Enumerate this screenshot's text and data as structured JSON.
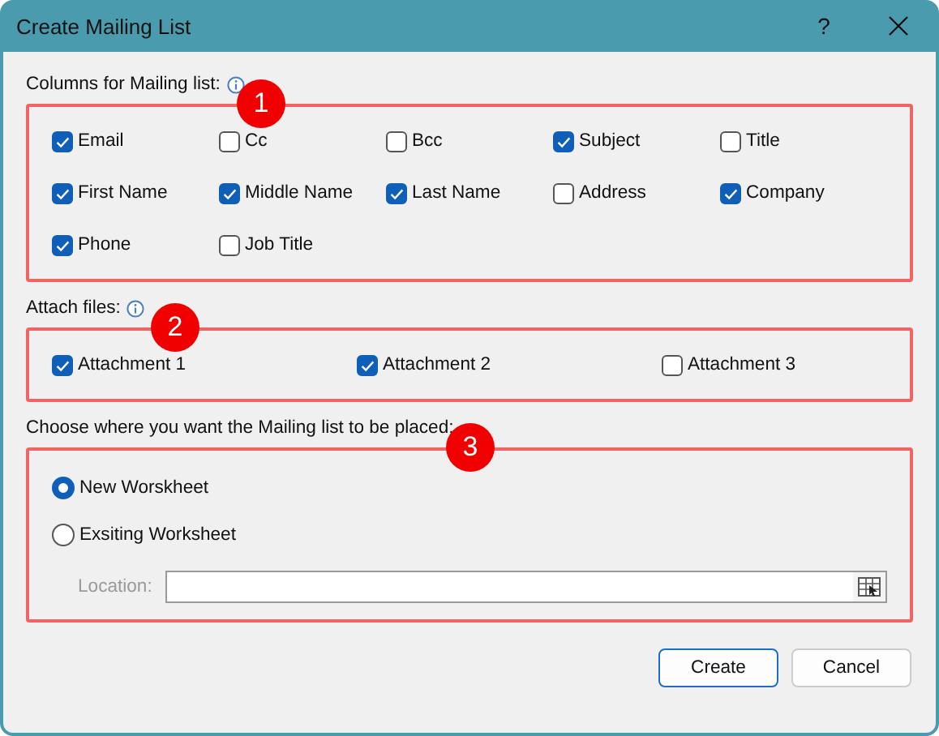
{
  "window": {
    "title": "Create Mailing List",
    "help": "?"
  },
  "sections": [
    {
      "kind": "checkboxes",
      "label": "Columns for Mailing list:",
      "info": true,
      "badge": "1",
      "items": [
        {
          "label": "Email",
          "checked": true
        },
        {
          "label": "Cc",
          "checked": false
        },
        {
          "label": "Bcc",
          "checked": false
        },
        {
          "label": "Subject",
          "checked": true
        },
        {
          "label": "Title",
          "checked": false
        },
        {
          "label": "First Name",
          "checked": true
        },
        {
          "label": "Middle Name",
          "checked": true
        },
        {
          "label": "Last Name",
          "checked": true
        },
        {
          "label": "Address",
          "checked": false
        },
        {
          "label": "Company",
          "checked": true
        },
        {
          "label": "Phone",
          "checked": true
        },
        {
          "label": "Job Title",
          "checked": false
        }
      ]
    },
    {
      "kind": "checkboxes",
      "label": "Attach files:",
      "info": true,
      "badge": "2",
      "items": [
        {
          "label": "Attachment 1",
          "checked": true
        },
        {
          "label": "Attachment 2",
          "checked": true
        },
        {
          "label": "Attachment 3",
          "checked": false
        }
      ]
    },
    {
      "kind": "radios",
      "label": "Choose where you want the Mailing list to be placed:",
      "info": false,
      "badge": "3",
      "items": [
        {
          "label": "New Worskheet",
          "selected": true
        },
        {
          "label": "Exsiting Worksheet",
          "selected": false
        }
      ],
      "location": {
        "label": "Location:",
        "disabled": true
      }
    }
  ],
  "buttons": [
    {
      "label": "Create",
      "default": true
    },
    {
      "label": "Cancel",
      "default": false
    }
  ]
}
